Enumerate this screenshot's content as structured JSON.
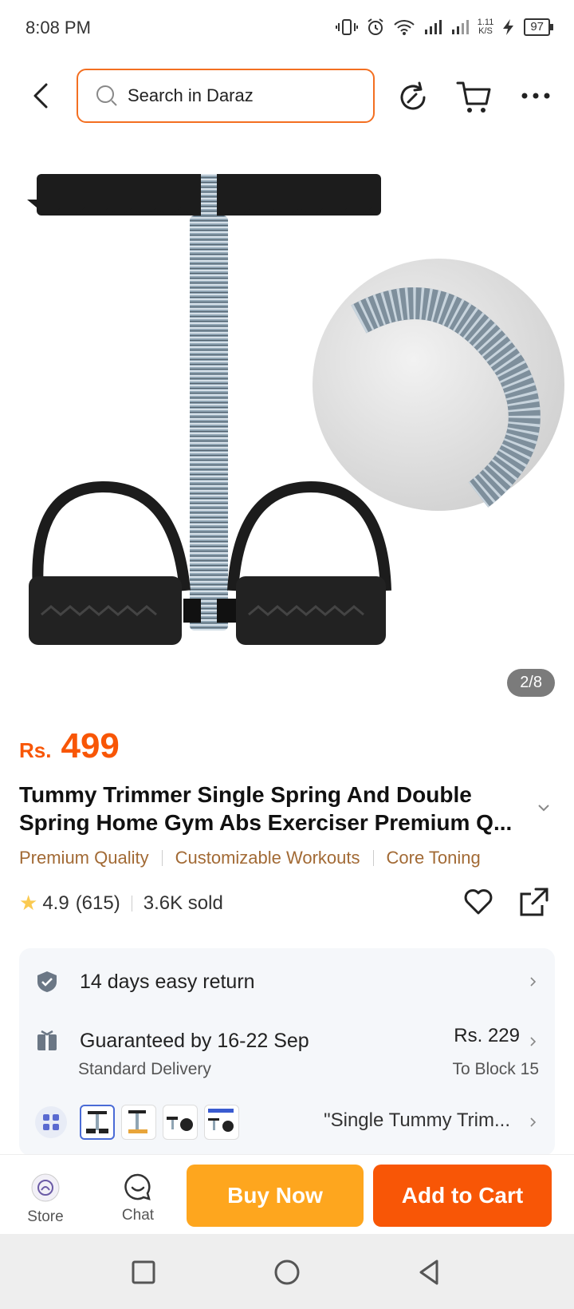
{
  "status_bar": {
    "time": "8:08 PM",
    "net_speed_top": "1.11",
    "net_speed_bottom": "K/S",
    "battery": "97"
  },
  "search": {
    "placeholder": "Search in Daraz"
  },
  "image_counter": "2/8",
  "price": {
    "currency": "Rs.",
    "amount": "499"
  },
  "product_title": "Tummy Trimmer Single Spring And Double Spring Home Gym Abs Exerciser Premium Q...",
  "tags": [
    "Premium Quality",
    "Customizable Workouts",
    "Core Toning"
  ],
  "rating": {
    "score": "4.9",
    "count": "(615)",
    "sold": "3.6K sold"
  },
  "services": {
    "return": "14 days easy return",
    "delivery_title": "Guaranteed by 16-22 Sep",
    "delivery_type": "Standard Delivery",
    "delivery_price": "Rs. 229",
    "delivery_location": "To Block 15",
    "variant_label": "\"Single Tummy Trim..."
  },
  "actions": {
    "store": "Store",
    "chat": "Chat",
    "buy_now": "Buy Now",
    "add_to_cart": "Add to Cart"
  },
  "colors": {
    "brand_orange": "#f85606",
    "buy_now": "#fea61e",
    "tag_brown": "#a26a35",
    "star": "#faca51"
  }
}
